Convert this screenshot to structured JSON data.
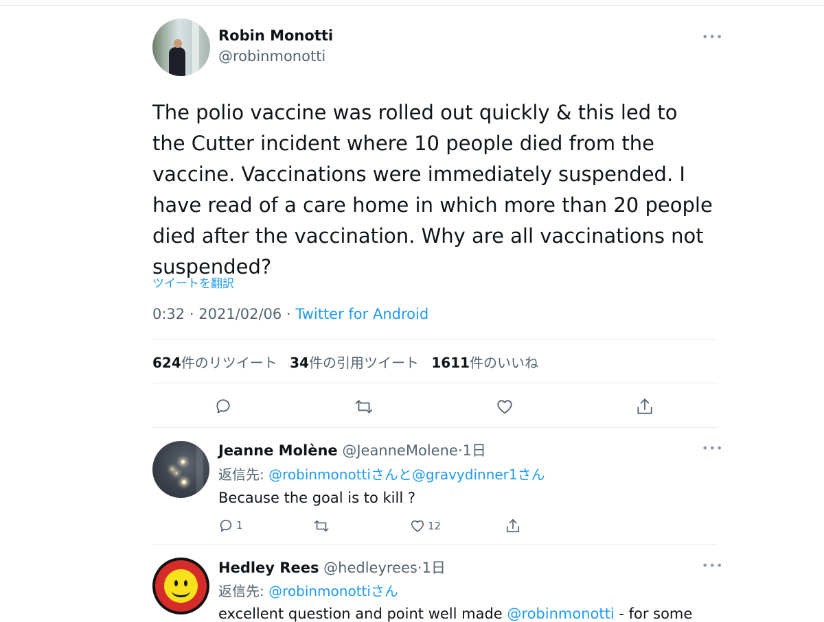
{
  "tweet": {
    "author_name": "Robin Monotti",
    "author_handle": "@robinmonotti",
    "more_icon": "more-dots-icon",
    "text": "The polio vaccine was rolled out quickly & this led to the Cutter incident where 10 people died from the vaccine. Vaccinations were immediately suspended. I have read of a care home in which more than 20 people died after the vaccination. Why are all vaccinations not suspended?",
    "translate_label": "ツイートを翻訳",
    "time": "0:32",
    "date": "2021/02/06",
    "separator": "·",
    "source": "Twitter for Android",
    "stats": {
      "retweets_count": "624",
      "retweets_label": "件のリツイート",
      "quotes_count": "34",
      "quotes_label": "件の引用ツイート",
      "likes_count": "1611",
      "likes_label": "件のいいね"
    },
    "actions": [
      "reply-icon",
      "retweet-icon",
      "like-icon",
      "share-icon"
    ]
  },
  "replies": [
    {
      "name": "Jeanne Molène",
      "handle": "@JeanneMolene",
      "age": "·1日",
      "reply_prefix": "返信先: ",
      "reply_targets": "@robinmonottiさんと@gravydinner1さん",
      "text": "Because the goal is to kill ?",
      "reply_count": "1",
      "retweet_count": "",
      "like_count": "12"
    },
    {
      "name": "Hedley Rees",
      "handle": "@hedleyrees",
      "age": "·1日",
      "reply_prefix": "返信先: ",
      "reply_targets": "@robinmonottiさん",
      "text_start": "excellent question and point well made ",
      "text_mention": "@robinmonotti",
      "text_end": " - for some"
    }
  ],
  "colors": {
    "link": "#1d9bf0",
    "secondary_text": "#536471",
    "primary_text": "#0f1419",
    "divider": "#e1e8ed"
  }
}
